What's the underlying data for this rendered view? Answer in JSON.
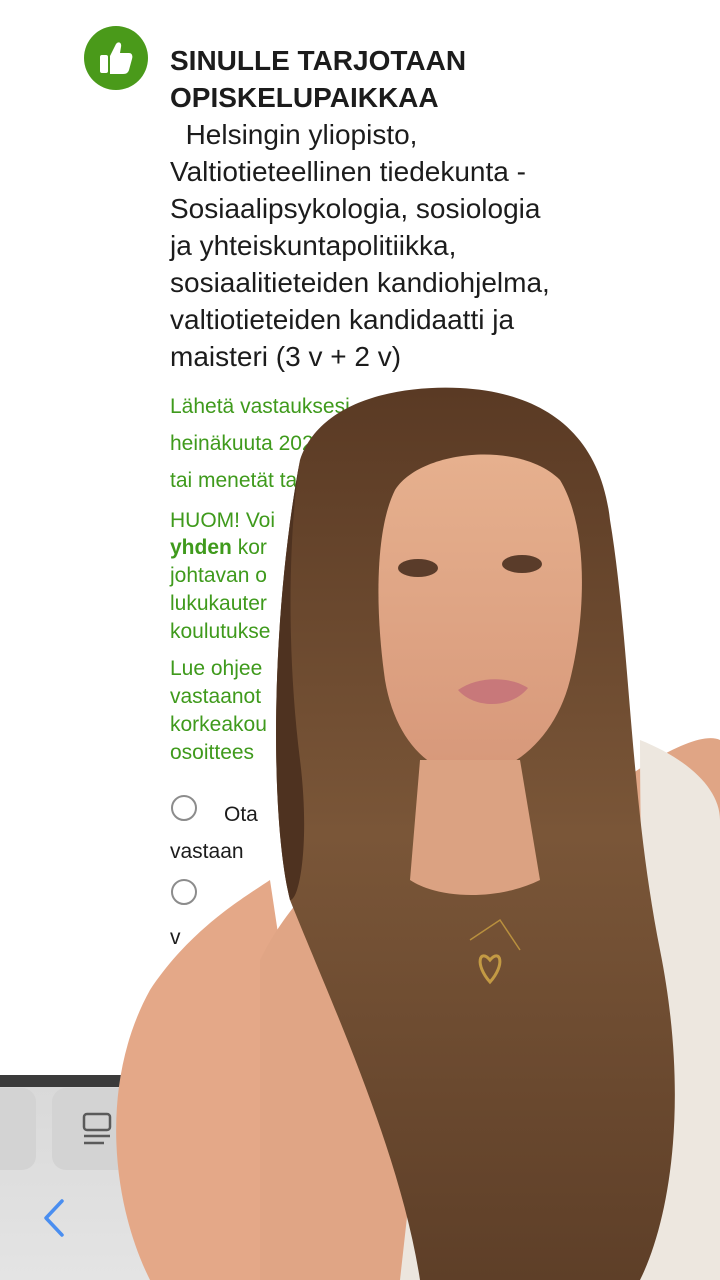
{
  "offer": {
    "title": "SINULLE TARJOTAAN OPISKELUPAIKKAA",
    "detail": "Helsingin yliopisto, Valtiotieteellinen tiedekunta - Sosiaalipsykologia, sosiologia ja yhteiskuntapolitiikka, sosiaalitieteiden kandiohjelma, valtiotieteiden kandidaatti ja maisteri (3 v + 2 v)"
  },
  "notice": {
    "line1": "Lähetä vastauksesi",
    "line2": "heinäkuuta 202",
    "line3": "tai menetät ta",
    "huom_lead": "HUOM! Voi",
    "huom_bold": "yhden",
    "huom_rest": "kor",
    "huom_line2": "johtavan o",
    "huom_line3": "lukukauter",
    "huom_line4": "koulutukse",
    "read_line1": "Lue ohjee",
    "read_line2": "vastaanot",
    "read_line3": "korkeakou",
    "read_line4": "osoittees"
  },
  "options": {
    "accept_line1": "Ota",
    "accept_line2": "vastaan",
    "other_line2": "v"
  },
  "colors": {
    "accent_green": "#3f9a1c",
    "thumb_green": "#4a9a1a"
  },
  "icons": {
    "offer_icon": "thumbs-up-icon",
    "tabs_icon": "tabs-overview-icon",
    "back_icon": "chevron-left-icon"
  }
}
